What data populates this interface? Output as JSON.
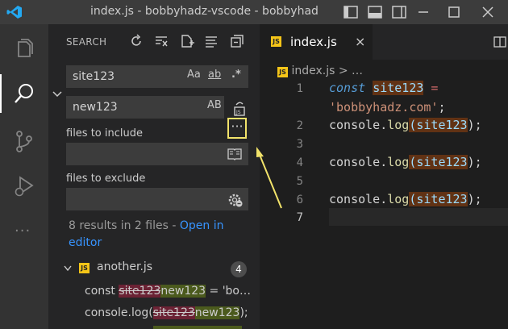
{
  "window": {
    "title": "index.js - bobbyhadz-vscode - bobbyhad"
  },
  "activity_bar": {
    "items": [
      "explorer-icon",
      "search-icon",
      "source-control-icon",
      "run-debug-icon",
      "more-icon"
    ],
    "more_label": "···"
  },
  "sidebar": {
    "title": "SEARCH",
    "search": {
      "value": "site123",
      "match_case": "Aa",
      "whole_word": "ab",
      "regex": ".*"
    },
    "replace": {
      "value": "new123",
      "preserve_case": "AB"
    },
    "ellipsis": "···",
    "include_label": "files to include",
    "exclude_label": "files to exclude",
    "results_message": "8 results in 2 files - ",
    "open_in_editor": "Open in editor",
    "file": {
      "name": "another.js",
      "count": "4",
      "icon_text": "JS"
    },
    "matches": [
      {
        "before": "const ",
        "old": "site123",
        "new": "new123",
        "after": " = 'bo…"
      },
      {
        "before": "console.log(",
        "old": "site123",
        "new": "new123",
        "after": ");"
      }
    ]
  },
  "editor": {
    "tab": {
      "name": "index.js",
      "icon_text": "JS",
      "close": "×"
    },
    "breadcrumb": {
      "file": "index.js",
      "rest": "> …"
    },
    "lines": [
      {
        "num": "1",
        "kw": "const",
        "var": "site123",
        "op": " ="
      },
      {
        "num": "",
        "str": "'bobbyhadz.com'",
        "op": ";"
      },
      {
        "num": "2",
        "obj": "console",
        "dot": ".",
        "fn": "log",
        "open": "(",
        "arg": "site123",
        "close": ");"
      },
      {
        "num": "3"
      },
      {
        "num": "4",
        "obj": "console",
        "dot": ".",
        "fn": "log",
        "open": "(",
        "arg": "site123",
        "close": ");"
      },
      {
        "num": "5"
      },
      {
        "num": "6",
        "obj": "console",
        "dot": ".",
        "fn": "log",
        "open": "(",
        "arg": "site123",
        "close": ");"
      },
      {
        "num": "7"
      }
    ]
  },
  "colors": {
    "highlight_box": "#f2e36a",
    "link": "#3794ff",
    "js_badge": "#f5c518"
  }
}
